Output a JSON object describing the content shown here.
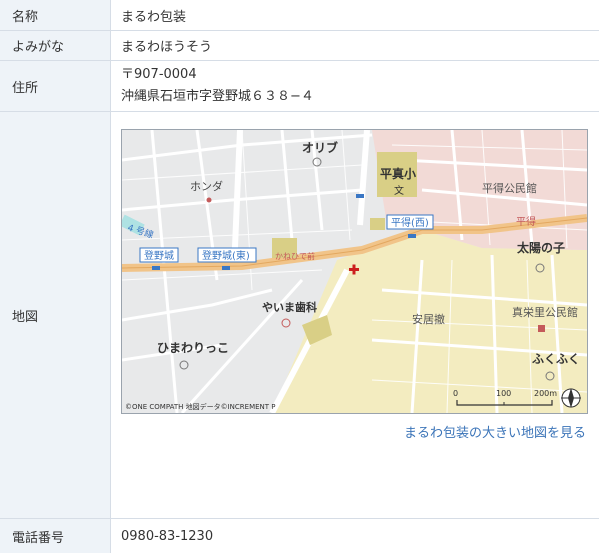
{
  "rows": {
    "name": {
      "label": "名称",
      "value": "まるわ包装"
    },
    "kana": {
      "label": "よみがな",
      "value": "まるわほうそう"
    },
    "address": {
      "label": "住所",
      "postal": "〒907-0004",
      "line": "沖縄県石垣市字登野城６３８−４"
    },
    "map": {
      "label": "地図",
      "link_text": "まるわ包装の大きい地図を見る"
    },
    "phone": {
      "label": "電話番号",
      "value": "0980-83-1230"
    }
  },
  "map": {
    "labels": {
      "olive": "オリブ",
      "honda": "ホンダ",
      "hirama_school": "平真小",
      "school_mark": "文",
      "heitoku_hall": "平得公民館",
      "heitoku_nishi": "平得(西)",
      "heitoku": "平得",
      "taiyo": "太陽の子",
      "tonoshiro": "登野城",
      "tonoshiro_higashi": "登野城(東)",
      "kawa_mae": "かねひで前",
      "route": "4 号線",
      "yaima_dental": "やいま歯科",
      "agaribaru": "安居撤",
      "maeezato_hall": "真栄里公民館",
      "himawari": "ひまわりっこ",
      "fukufuku": "ふくふく",
      "scale_0": "0",
      "scale_100": "100",
      "scale_200": "200m",
      "copyright": "©ONE COMPATH 地図データ©INCREMENT P"
    },
    "colors": {
      "base": "#e8e9ea",
      "yellow_zone": "#f3ecc0",
      "pink_zone": "#f2dad6",
      "road": "#ffffff",
      "main_road": "#f1c489",
      "marker": "#cc1f1f",
      "station": "#3a77c4"
    }
  }
}
